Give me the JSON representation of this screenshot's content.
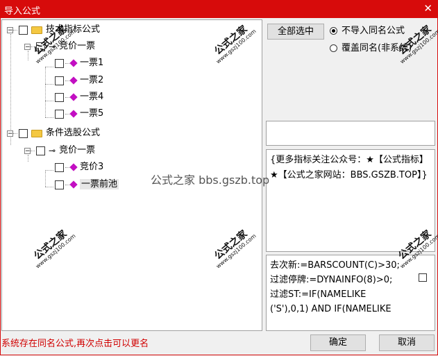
{
  "window": {
    "title": "导入公式",
    "close_glyph": "✕"
  },
  "tree": {
    "group1": {
      "label": "技术指标公式",
      "child": {
        "label": "竞价一票",
        "items": [
          "一票1",
          "一票2",
          "一票4",
          "一票5"
        ]
      }
    },
    "group2": {
      "label": "条件选股公式",
      "child": {
        "label": "竞价一票",
        "items": [
          "竞价3",
          "一票前池"
        ]
      }
    },
    "expander_open": "−"
  },
  "buttons": {
    "select_all": "全部选中",
    "ok": "确定",
    "cancel": "取消"
  },
  "radios": {
    "no_import": "不导入同名公式",
    "overwrite": "覆盖同名(非系统)"
  },
  "description": "{更多指标关注公众号：★【公式指标】★【公式之家网站：BBS.GSZB.TOP】}",
  "formula_lines": [
    "去次新:=BARSCOUNT(C)>30;",
    "过滤停牌:=DYNAINFO(8)>0;",
    "过滤ST:=IF(NAMELIKE",
    "('S'),0,1) AND IF(NAMELIKE"
  ],
  "status": "系统存在同名公式,再次点击可以更名",
  "watermark": {
    "text": "公式之家",
    "url": "www.gszj100.com",
    "center": "公式之家 bbs.gszb.top"
  },
  "icons": {
    "folder": "folder-icon",
    "key": "⊸",
    "formula": "formula-icon"
  },
  "colors": {
    "title_bar": "#d70b0b",
    "status_text": "#d00000",
    "formula_icon": "#c20fc2"
  }
}
